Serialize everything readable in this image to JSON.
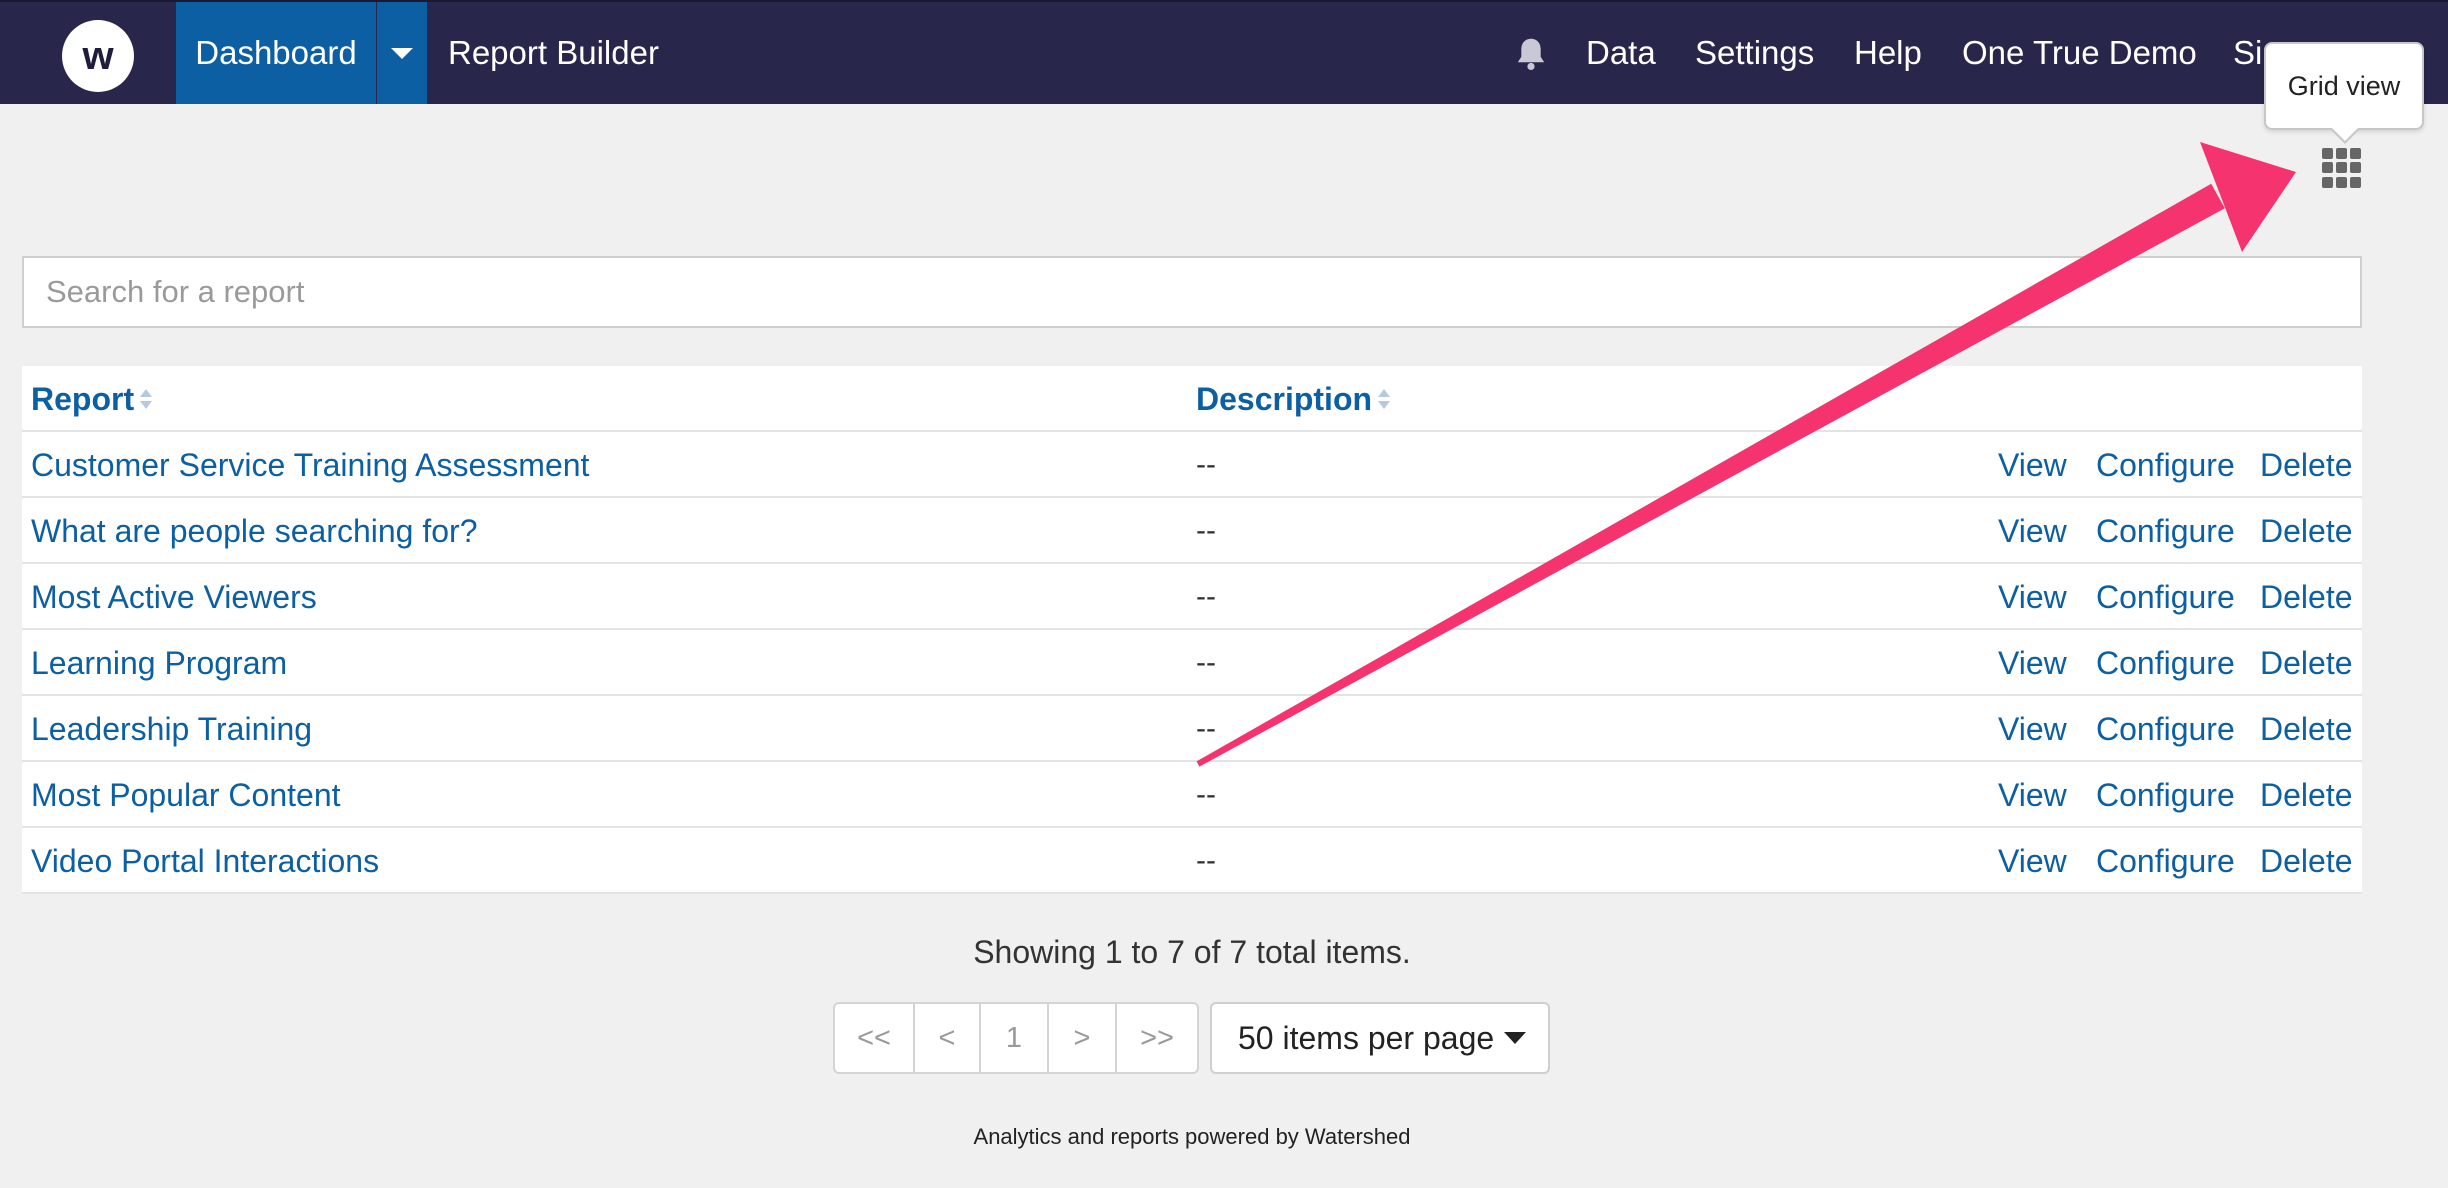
{
  "navbar": {
    "logo_text": "w",
    "dashboard_label": "Dashboard",
    "report_builder_label": "Report Builder",
    "links": [
      {
        "name": "nav-data",
        "label": "Data"
      },
      {
        "name": "nav-settings",
        "label": "Settings"
      },
      {
        "name": "nav-help",
        "label": "Help"
      },
      {
        "name": "nav-account",
        "label": "One True Demo"
      },
      {
        "name": "nav-sign-out",
        "label": "Si"
      }
    ],
    "bell_icon": "bell-icon",
    "background_color": "#28264a",
    "active_color": "#0d5fa4"
  },
  "tooltip": {
    "text": "Grid view"
  },
  "grid_view_icon": "grid-icon",
  "search": {
    "placeholder": "Search for a report",
    "value": ""
  },
  "table": {
    "columns": {
      "report": "Report",
      "description": "Description"
    },
    "rows": [
      {
        "name": "Customer Service Training Assessment",
        "description": "--"
      },
      {
        "name": "What are people searching for?",
        "description": "--"
      },
      {
        "name": "Most Active Viewers",
        "description": "--"
      },
      {
        "name": "Learning Program",
        "description": "--"
      },
      {
        "name": "Leadership Training",
        "description": "--"
      },
      {
        "name": "Most Popular Content",
        "description": "--"
      },
      {
        "name": "Video Portal Interactions",
        "description": "--"
      }
    ],
    "actions": {
      "view": "View",
      "configure": "Configure",
      "delete": "Delete"
    }
  },
  "pagination": {
    "showing_text": "Showing 1 to 7 of 7 total items.",
    "first": "<<",
    "prev": "<",
    "current": "1",
    "next": ">",
    "last": ">>",
    "per_page": "50 items per page"
  },
  "footer": {
    "powered_by": "Analytics and reports powered by Watershed"
  },
  "annotation": {
    "arrow_color": "#f5336e"
  }
}
